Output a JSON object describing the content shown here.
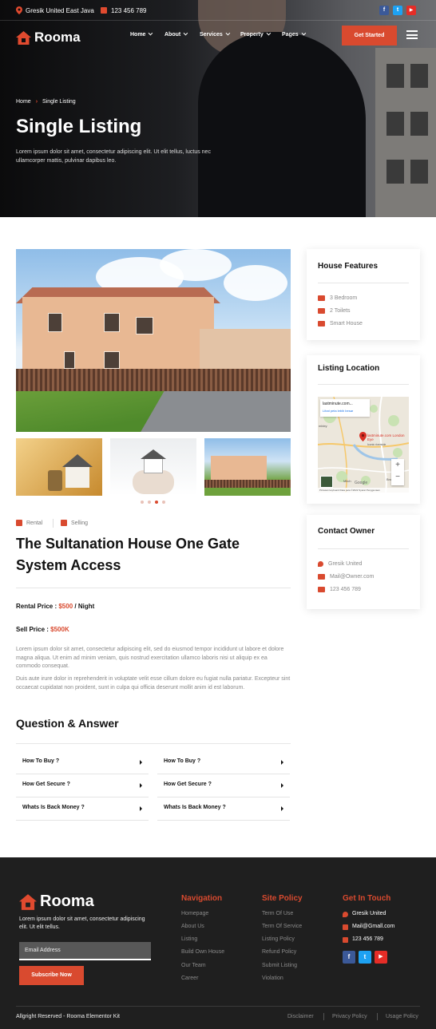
{
  "topbar": {
    "location": "Gresik United East Java",
    "phone": "123 456 789",
    "social": [
      "f",
      "t",
      "▶"
    ]
  },
  "nav": {
    "brand": "Rooma",
    "menu": [
      "Home",
      "About",
      "Services",
      "Property",
      "Pages"
    ],
    "cta": "Get Started"
  },
  "hero": {
    "breadcrumb_home": "Home",
    "breadcrumb_sep": "›",
    "breadcrumb_current": "Single Listing",
    "title": "Single Listing",
    "description": "Lorem ipsum dolor sit amet, consectetur adipiscing elit. Ut elit tellus, luctus nec ullamcorper mattis, pulvinar dapibus leo."
  },
  "listing": {
    "tags": [
      "Rental",
      "Selling"
    ],
    "title": "The Sultanation House One Gate System Access",
    "rental_label": "Rental Price : ",
    "rental_value": "$500",
    "rental_suffix": " / Night",
    "sell_label": "Sell Price : ",
    "sell_value": "$500K",
    "para1": "Lorem ipsum dolor sit amet, consectetur adipiscing elit, sed do eiusmod tempor incididunt ut labore et dolore magna aliqua. Ut enim ad minim veniam, quis nostrud exercitation ullamco laboris nisi ut aliquip ex ea commodo consequat.",
    "para2": "Duis aute irure dolor in reprehenderit in voluptate velit esse cillum dolore eu fugiat nulla pariatur. Excepteur sint occaecat cupidatat non proident, sunt in culpa qui officia deserunt mollit anim id est laborum.",
    "slider_active": 3
  },
  "qa": {
    "title": "Question & Answer",
    "left": [
      "How To Buy ?",
      "How Get Secure ?",
      "Whats Is Back Money ?"
    ],
    "right": [
      "How To Buy ?",
      "How Get Secure ?",
      "Whats Is Back Money ?"
    ]
  },
  "features": {
    "title": "House Features",
    "items": [
      "3 Bedroom",
      "2 Toilets",
      "Smart House"
    ]
  },
  "location": {
    "title": "Listing Location",
    "map_place": "lastminute.com...",
    "map_link": "Lihat peta lebih besar",
    "pin_label": "lastminute.com London Eye",
    "pin_sub": "Iconic riverside",
    "map_place2": "mbley",
    "map_place3": "Mitch",
    "map_place4": "Bro",
    "zoom_in": "+",
    "zoom_out": "−",
    "map_footer": "Pintasan keyboard   Data peta ©2022   Syarat Penggunaan",
    "google": "Google"
  },
  "contact": {
    "title": "Contact Owner",
    "address": "Gresik United",
    "email": "Mail@Owner.com",
    "phone": "123 456 789"
  },
  "footer": {
    "brand": "Rooma",
    "description": "Lorem ipsum dolor sit amet, consectetur adipiscing elit. Ut elit tellus.",
    "email_placeholder": "Email Address",
    "subscribe": "Subscribe Now",
    "nav_title": "Navigation",
    "nav_links": [
      "Homepage",
      "About Us",
      "Listing",
      "Build Own House",
      "Our Team",
      "Career"
    ],
    "policy_title": "Site Policy",
    "policy_links": [
      "Term Of Use",
      "Term Of Service",
      "Listing Policy",
      "Refund Policy",
      "Submit Listing",
      "Violation"
    ],
    "touch_title": "Get In Touch",
    "touch_address": "Gresik United",
    "touch_email": "Mail@Gmall.com",
    "touch_phone": "123 456 789",
    "social": [
      "f",
      "t",
      "▶"
    ],
    "copyright": "Allgright Reserved - Rooma Elementor Kit",
    "bottom_links": [
      "Disclaimer",
      "Privacy Policy",
      "Usage Policy"
    ]
  },
  "colors": {
    "accent": "#d94a2f",
    "facebook": "#3b5998",
    "twitter": "#1da1f2",
    "youtube": "#e52d27",
    "footer_bg": "#1f1f1f"
  }
}
